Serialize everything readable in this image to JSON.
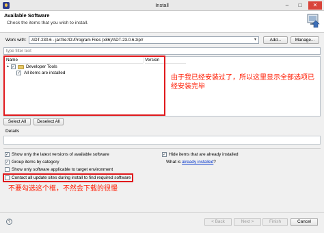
{
  "window": {
    "title": "Install",
    "minimize": "–",
    "maximize": "□",
    "close": "✕"
  },
  "header": {
    "title": "Available Software",
    "description": "Check the items that you wish to install."
  },
  "work_with": {
    "label": "Work with:",
    "value": "ADT-230.6 - jar:file:/D:/Program Files (x86)/ADT-23.0.6.zip!/",
    "add_label": "Add...",
    "manage_label": "Manage..."
  },
  "filter": {
    "placeholder": "type filter text"
  },
  "table": {
    "columns": [
      "Name",
      "Version"
    ],
    "group": {
      "label": "Developer Tools",
      "expander": "▲",
      "checked": true
    },
    "item": {
      "label": "All items are installed",
      "checked": true
    }
  },
  "annotations": {
    "top": "由于我已经安装过了，所以这里显示全部选项已经安装完毕",
    "bottom": "不要勾选这个框，不然会下载的很慢"
  },
  "selection_buttons": {
    "select_all": "Select All",
    "deselect_all": "Deselect All"
  },
  "details": {
    "label": "Details"
  },
  "options": {
    "latest_versions": {
      "label": "Show only the latest versions of available software",
      "checked": true
    },
    "group_by_category": {
      "label": "Group items by category",
      "checked": true
    },
    "applicable_only": {
      "label": "Show only software applicable to target environment",
      "checked": false
    },
    "contact_sites": {
      "label": "Contact all update sites during install to find required software",
      "checked": false
    },
    "hide_installed": {
      "label": "Hide items that are already installed",
      "checked": true
    },
    "what_is_installed_prefix": "What is",
    "already_installed_link": "already installed",
    "what_is_installed_suffix": "?"
  },
  "footer": {
    "help": "?",
    "back_label": "< Back",
    "next_label": "Next >",
    "finish_label": "Finish",
    "cancel_label": "Cancel"
  },
  "colors": {
    "annotation_red": "#e0181b",
    "link_blue": "#0033cc"
  },
  "icons": [
    "app-icon",
    "install-banner-icon",
    "folder-icon",
    "help-icon",
    "chevron-down-icon"
  ]
}
